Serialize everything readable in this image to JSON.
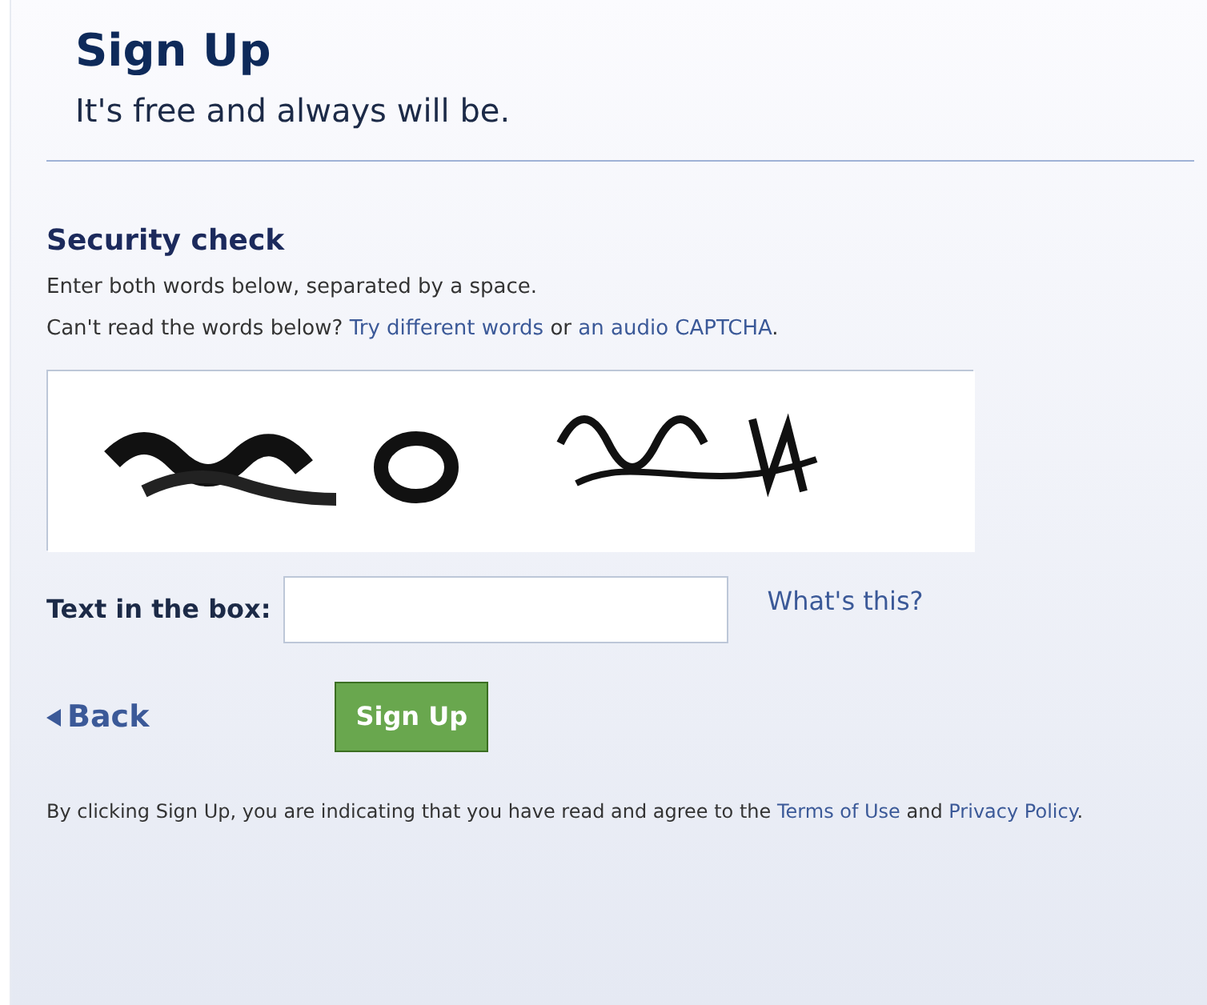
{
  "header": {
    "title": "Sign Up",
    "subtitle": "It's free and always will be."
  },
  "security": {
    "heading": "Security check",
    "lines": [
      [
        {
          "kind": "text",
          "text": "Enter both words below, separated by a space."
        }
      ],
      [
        {
          "kind": "text",
          "text": "Can't read the words below? "
        },
        {
          "kind": "link",
          "text": "Try different words"
        },
        {
          "kind": "text",
          "text": " or "
        },
        {
          "kind": "link",
          "text": "an audio CAPTCHA"
        },
        {
          "kind": "text",
          "text": "."
        }
      ]
    ],
    "captcha": {
      "kind": "picture"
    },
    "field": {
      "label": "Text in the box:",
      "help": "What's this?"
    }
  },
  "actions": {
    "back": "Back",
    "submit": "Sign Up"
  },
  "footer": [
    {
      "kind": "text",
      "text": "By clicking Sign Up, you are indicating that you have read and agree to the "
    },
    {
      "kind": "link",
      "text": "Terms of Use"
    },
    {
      "kind": "text",
      "text": " and "
    },
    {
      "kind": "link",
      "text": "Privacy Policy"
    },
    {
      "kind": "text",
      "text": "."
    }
  ]
}
